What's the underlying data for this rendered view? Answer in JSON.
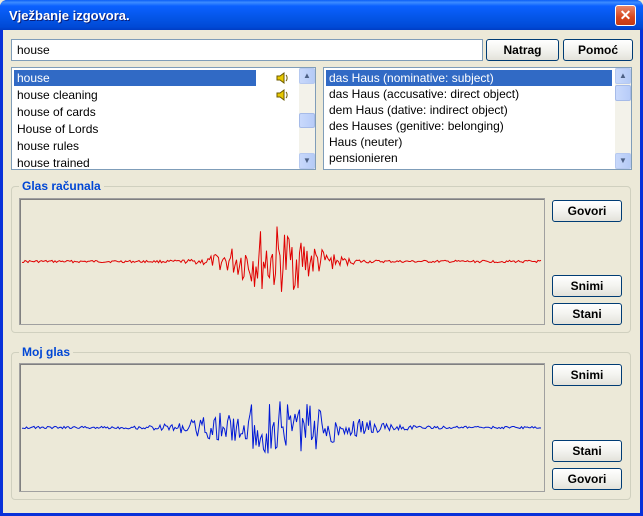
{
  "window": {
    "title": "Vježbanje izgovora."
  },
  "search": {
    "value": "house"
  },
  "buttons": {
    "back": "Natrag",
    "help": "Pomoć",
    "computer_speak": "Govori",
    "computer_record": "Snimi",
    "computer_stop": "Stani",
    "my_record": "Snimi",
    "my_stop": "Stani",
    "my_speak": "Govori"
  },
  "word_list": {
    "items": [
      {
        "label": "house",
        "selected": true,
        "has_audio": true
      },
      {
        "label": "house cleaning",
        "selected": false,
        "has_audio": true
      },
      {
        "label": "house of cards",
        "selected": false,
        "has_audio": false
      },
      {
        "label": "House of Lords",
        "selected": false,
        "has_audio": false
      },
      {
        "label": "house rules",
        "selected": false,
        "has_audio": false
      },
      {
        "label": "house trained",
        "selected": false,
        "has_audio": false
      }
    ]
  },
  "translation_list": {
    "items": [
      {
        "label": "das Haus (nominative: subject)",
        "selected": true
      },
      {
        "label": "das Haus (accusative: direct object)",
        "selected": false
      },
      {
        "label": "dem Haus (dative: indirect object)",
        "selected": false
      },
      {
        "label": "des Hauses (genitive: belonging)",
        "selected": false
      },
      {
        "label": "Haus (neuter)",
        "selected": false
      },
      {
        "label": "pensionieren",
        "selected": false
      }
    ]
  },
  "groups": {
    "computer_voice": "Glas računala",
    "my_voice": "Moj glas"
  },
  "colors": {
    "computer_wave": "#e00000",
    "my_wave": "#0019d6",
    "group_label": "#0046d5",
    "selection": "#316ac5"
  },
  "icons": {
    "close": "close-icon",
    "speaker": "speaker-icon"
  }
}
